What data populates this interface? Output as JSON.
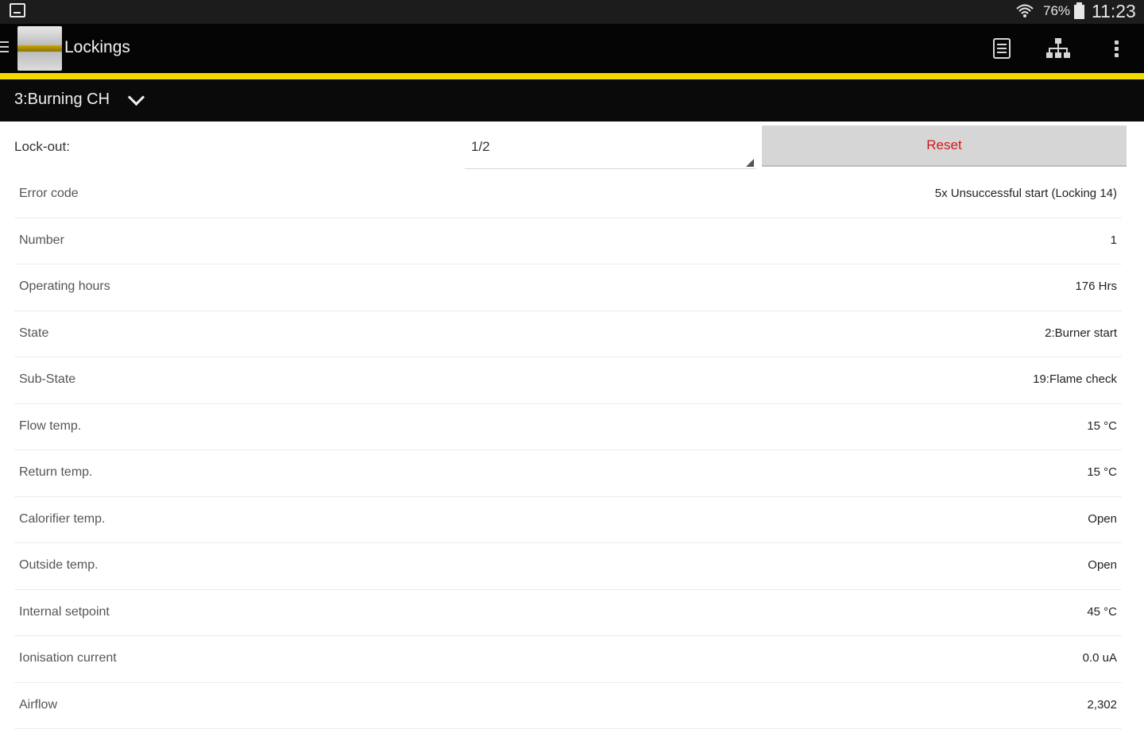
{
  "status_bar": {
    "battery_percent": "76%",
    "time": "11:23"
  },
  "app_bar": {
    "title": "Lockings",
    "actions": [
      "document-icon",
      "hierarchy-icon",
      "overflow-menu-icon"
    ]
  },
  "mode_selector": {
    "value": "3:Burning CH"
  },
  "lockout": {
    "label": "Lock-out:",
    "selected": "1/2",
    "reset_label": "Reset"
  },
  "details": [
    {
      "label": "Error code",
      "value": "5x Unsuccessful start (Locking 14)"
    },
    {
      "label": "Number",
      "value": "1"
    },
    {
      "label": "Operating hours",
      "value": "176 Hrs"
    },
    {
      "label": "State",
      "value": "2:Burner start"
    },
    {
      "label": "Sub-State",
      "value": "19:Flame check"
    },
    {
      "label": "Flow temp.",
      "value": "15 °C"
    },
    {
      "label": "Return temp.",
      "value": "15 °C"
    },
    {
      "label": "Calorifier temp.",
      "value": "Open"
    },
    {
      "label": "Outside temp.",
      "value": "Open"
    },
    {
      "label": "Internal setpoint",
      "value": "45 °C"
    },
    {
      "label": "Ionisation current",
      "value": "0.0 uA"
    },
    {
      "label": "Airflow",
      "value": "2,302"
    }
  ],
  "colors": {
    "accent_yellow": "#f2dc00",
    "reset_text": "#d21919",
    "toolbar": "#050505"
  }
}
